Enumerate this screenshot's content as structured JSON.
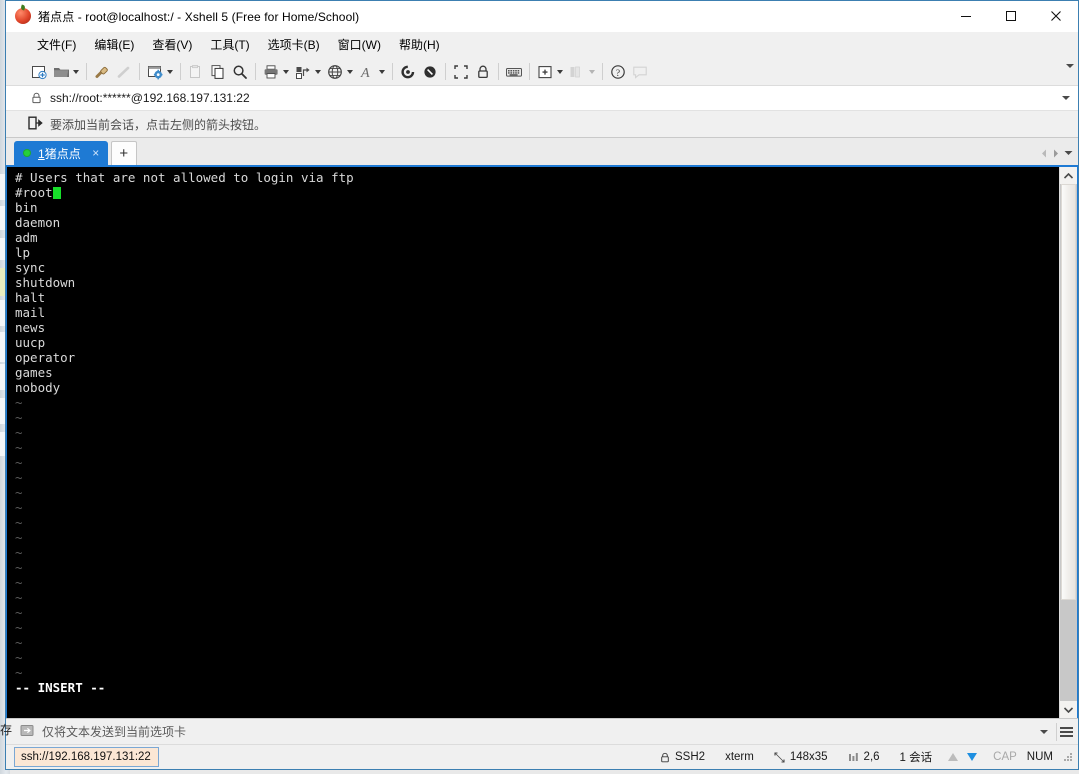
{
  "window": {
    "title": "猪点点 - root@localhost:/ - Xshell 5 (Free for Home/School)",
    "app_icon": "xshell-logo-icon",
    "minimize": "—",
    "maximize": "□",
    "close": "✕",
    "accent_color": "#1e7ad4"
  },
  "menu": {
    "items": [
      {
        "label": "文件(F)",
        "name": "menu-file"
      },
      {
        "label": "编辑(E)",
        "name": "menu-edit"
      },
      {
        "label": "查看(V)",
        "name": "menu-view"
      },
      {
        "label": "工具(T)",
        "name": "menu-tools"
      },
      {
        "label": "选项卡(B)",
        "name": "menu-tab"
      },
      {
        "label": "窗口(W)",
        "name": "menu-window"
      },
      {
        "label": "帮助(H)",
        "name": "menu-help"
      }
    ]
  },
  "toolbar": {
    "expand_label": "▾",
    "buttons": [
      "new-session-icon",
      "open-folder-icon",
      "folder-dropdown-caret",
      "connect-icon",
      "disconnect-icon",
      "session-properties-icon",
      "properties-dropdown-caret",
      "copy-paste-icon",
      "copy-icon",
      "find-icon",
      "print-icon",
      "print-dropdown-caret",
      "layout-icon",
      "layout-dropdown-caret",
      "globe-icon",
      "globe-dropdown-caret",
      "font-icon",
      "font-dropdown-caret",
      "log-start-icon",
      "log-stop-icon",
      "fullscreen-icon",
      "lock-icon",
      "keyboard-icon",
      "add-tab-icon",
      "add-tab-dropdown-caret",
      "arrange-icon",
      "arrange-dropdown-caret",
      "help-icon",
      "comment-icon"
    ]
  },
  "address_bar": {
    "lock_icon": "lock-icon",
    "value": "ssh://root:******@192.168.197.131:22",
    "dropdown_icon": "chevron-down-icon"
  },
  "notice_bar": {
    "icon": "add-session-icon",
    "text": "要添加当前会话，点击左侧的箭头按钮。"
  },
  "tabs": {
    "session": {
      "label_number": "1",
      "label_name": "猪点点",
      "status_dot_color": "#26d03a",
      "close_label": "×"
    },
    "new_tab_label": "+",
    "nav_prev": "◀",
    "nav_next": "▶",
    "nav_menu": "▾"
  },
  "terminal": {
    "background": "#000000",
    "foreground": "#d9d9d9",
    "cursor_color": "#17e02a",
    "lines": [
      "# Users that are not allowed to login via ftp",
      "#root",
      "bin",
      "daemon",
      "adm",
      "lp",
      "sync",
      "shutdown",
      "halt",
      "mail",
      "news",
      "uucp",
      "operator",
      "games",
      "nobody"
    ],
    "cursor_line_index": 1,
    "tilde_count": 19,
    "tilde_char": "~",
    "status_line": "-- INSERT --"
  },
  "send_bar": {
    "icon": "send-to-tab-icon",
    "text": "仅将文本发送到当前选项卡",
    "dropdown_icon": "chevron-down-icon",
    "menu_icon": "hamburger-menu-icon"
  },
  "status_bar": {
    "link": "ssh://192.168.197.131:22",
    "protocol_icon": "lock-icon",
    "protocol": "SSH2",
    "terminal_type": "xterm",
    "size_icon": "resize-icon",
    "size": "148x35",
    "position_icon": "cursor-position-icon",
    "position": "2,6",
    "sessions": "1 会话",
    "upload_icon": "arrow-up-icon",
    "download_icon": "arrow-down-icon",
    "caps": "CAP",
    "num": "NUM",
    "grip": "resize-grip-icon"
  }
}
